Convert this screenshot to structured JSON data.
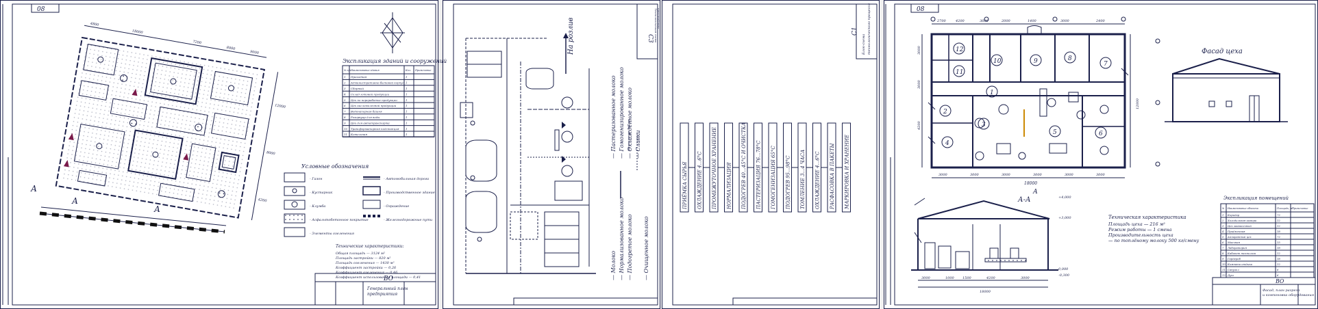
{
  "sheet1": {
    "corner": "08",
    "title": "Экспликация зданий и сооружений",
    "expl_headers": [
      "№ п/п",
      "Наименование здания",
      "Кол.",
      "Примечание"
    ],
    "expl_rows": [
      [
        "1",
        "Проходная",
        "1",
        ""
      ],
      [
        "2",
        "Административно-бытовой корпус",
        "1",
        ""
      ],
      [
        "3",
        "Сборный",
        "1",
        ""
      ],
      [
        "4",
        "Склад готовой продукции",
        "1",
        ""
      ],
      [
        "5",
        "Цех по переработке продукции",
        "1",
        ""
      ],
      [
        "6",
        "Цех кисломолочной продукции",
        "1",
        ""
      ],
      [
        "7",
        "Водонапорная башня",
        "1",
        ""
      ],
      [
        "8",
        "Резервуар для воды",
        "1",
        ""
      ],
      [
        "9",
        "Цех для автотранспорта",
        "1",
        ""
      ],
      [
        "10",
        "Трансформаторная подстанция",
        "1",
        ""
      ],
      [
        "11",
        "Котельная",
        "1",
        ""
      ]
    ],
    "legend_title": "Условные обозначения",
    "legend_left": [
      "- Газон",
      "- Кустарник",
      "- Клумба",
      "- Асфальтобетонное покрытие",
      "- Элементы озеленения"
    ],
    "legend_right": [
      "- Автомобильная дорога",
      "- Производственное здание",
      "- Ограждение",
      "- Железнодорожные пути"
    ],
    "tech_title": "Технические характеристики:",
    "tech_lines": [
      "Общая площадь — 3124 м²",
      "Площадь застройки — 820 м²",
      "Площадь озеленения — 1430 м²",
      "Коэффициент застройки — 0,26",
      "Коэффициент озеленения — 0,46",
      "Коэффициент использования площади — 0,41"
    ],
    "stamp_code": "ВО",
    "stamp_title": [
      "Генеральный план",
      "предприятия"
    ],
    "section_mark": "А",
    "dims_top": [
      "4800",
      "18000",
      "7200",
      "8000",
      "9000"
    ],
    "dims_side": [
      "12000",
      "8000",
      "4200"
    ]
  },
  "sheet2": {
    "flow_label": "На розлив",
    "code": "С3",
    "legend": [
      "— Молоко",
      "— Нормализованное молоко",
      "— Подогретое молоко",
      "— Пастеризованное молоко",
      "— Гомогенизированное молоко",
      "— Охлаждённое молоко",
      "— Сливки",
      "— Очищенное молоко"
    ],
    "frame_title": [
      "Технологическая схема",
      "производства"
    ]
  },
  "sheet3": {
    "code": "С1",
    "frame_title": [
      "Блок-схема",
      "технологического процесса"
    ],
    "steps": [
      "ПРИЁМКА СЫРЬЯ",
      "ОХЛАЖДЕНИЕ 4...6°С",
      "ПРОМЕЖУТОЧНОЕ ХРАНЕНИЕ",
      "НОРМАЛИЗАЦИЯ",
      "ПОДОГРЕВ 40...45°С И ОЧИСТКА",
      "ПАСТЕРИЗАЦИЯ 76...78°С",
      "ГОМОГЕНИЗАЦИЯ 65°С",
      "ПОДОГРЕВ 95...98°С",
      "ТОМЛЕНИЕ 3...4 ЧАСА",
      "ОХЛАЖДЕНИЕ 4...6°С",
      "РАСФАСОВКА В ПАКЕТЫ",
      "МАРКИРОВКА И ХРАНЕНИЕ"
    ]
  },
  "sheet4": {
    "corner": "08",
    "facade_title": "Фасад цеха",
    "section_title": "А-А",
    "section_mark": "А",
    "room_numbers": [
      "1",
      "2",
      "3",
      "4",
      "5",
      "6",
      "7",
      "8",
      "9",
      "10",
      "11",
      "12"
    ],
    "dims_top": [
      "2700",
      "4200",
      "3600",
      "2000",
      "1400",
      "3000",
      "2400"
    ],
    "dim_total": "18000",
    "dims_bottom": [
      "3000",
      "3000",
      "3000",
      "3000",
      "3000",
      "3000"
    ],
    "dims_side": [
      "3000",
      "3000",
      "4200",
      "12000"
    ],
    "levels": [
      "+4,000",
      "+3,000",
      "0,000",
      "-0,300"
    ],
    "section_dims": [
      "3000",
      "1000",
      "1500",
      "4200",
      "3000",
      "18000"
    ],
    "tech_title": "Техническая характеристика",
    "tech_lines": [
      "Площадь цеха — 216 м²",
      "Режим работы — 1 смена",
      "Производительность цеха",
      "— по топлёному молоку 500 кг/смену"
    ],
    "expl_title": "Экспликация помещений",
    "expl_headers": [
      "№",
      "Наименование объекта",
      "Площадь, м²",
      "Примечание"
    ],
    "expl_rows": [
      [
        "1",
        "Коридор",
        "72",
        ""
      ],
      [
        "2",
        "Холодильная камера",
        "12",
        ""
      ],
      [
        "3",
        "Цех заквасочный",
        "12",
        ""
      ],
      [
        "4",
        "Приёмочная",
        "18",
        ""
      ],
      [
        "5",
        "Аппаратный цех",
        "72",
        ""
      ],
      [
        "6",
        "Моечная",
        "15",
        ""
      ],
      [
        "7",
        "Лаборатория",
        "18",
        ""
      ],
      [
        "8",
        "Кабинет технолога",
        "12",
        ""
      ],
      [
        "9",
        "Гардероб",
        "18",
        ""
      ],
      [
        "10",
        "Комната отдыха",
        "12",
        ""
      ],
      [
        "11",
        "Санузел",
        "6",
        ""
      ],
      [
        "12",
        "Душ",
        "6",
        ""
      ]
    ],
    "stamp_code": "ВО",
    "stamp_title": [
      "Фасад, план разреза",
      "и компоновка оборудования"
    ]
  }
}
